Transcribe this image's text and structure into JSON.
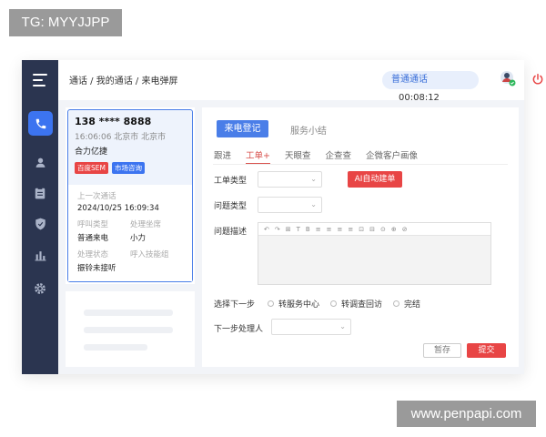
{
  "watermarks": {
    "top_left": "TG: MYYJJPP",
    "bottom_right": "www.penpapi.com"
  },
  "sidebar": {
    "icons": [
      "menu-icon",
      "phone-icon",
      "user-icon",
      "clipboard-icon",
      "shield-icon",
      "bar-chart-icon",
      "gear-icon"
    ],
    "active": "phone-icon"
  },
  "header": {
    "breadcrumb": "通话 / 我的通话 / 来电弹屏",
    "status_label": "普通通话",
    "timer": "00:08:12"
  },
  "caller_card": {
    "phone": "138 **** 8888",
    "time_location": "16:06:06  北京市 北京市",
    "company": "合力亿捷",
    "tags": [
      "百度SEM",
      "市场咨询"
    ],
    "last_call_label": "上一次通话",
    "last_call_value": "2024/10/25  16:09:34",
    "call_type_label": "呼叫类型",
    "call_type_value": "普通来电",
    "handler_label": "处理坐席",
    "handler_value": "小力",
    "status_label": "处理状态",
    "status_value": "振铃未接听",
    "skill_group_label": "呼入技能组"
  },
  "main": {
    "tab_active": "来电登记",
    "tab_other": "服务小结",
    "subtabs": [
      "跟进",
      "工单+",
      "天眼查",
      "企查查",
      "企微客户画像"
    ],
    "subtab_active_index": 1,
    "ticket_type_label": "工单类型",
    "issue_type_label": "问题类型",
    "ai_button": "AI自动建单",
    "issue_desc_label": "问题描述",
    "editor_tools": [
      "↶",
      "↷",
      "⊞",
      "T",
      "B",
      "≡",
      "≡",
      "≡",
      "≡",
      "⊡",
      "⊟",
      "⊙",
      "⊕",
      "⊘"
    ],
    "next_step_label": "选择下一步",
    "next_step_options": [
      "转服务中心",
      "转调查回访",
      "完结"
    ],
    "next_handler_label": "下一步处理人",
    "save_button": "暂存",
    "submit_button": "提交"
  },
  "colors": {
    "sidebar": "#2b3550",
    "accent": "#4a7ee8",
    "danger": "#e84545"
  }
}
